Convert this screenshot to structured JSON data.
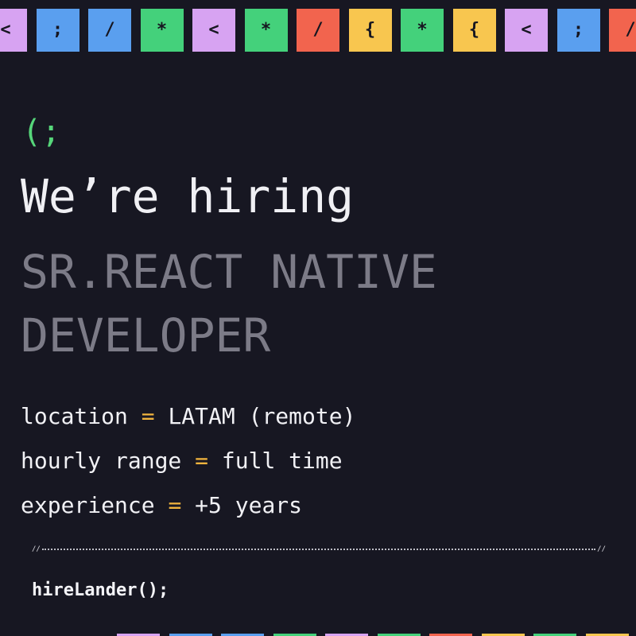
{
  "colors": {
    "background": "#171722",
    "purple": "#d7a3f2",
    "blue": "#5a9fef",
    "green": "#44d17b",
    "red": "#f2644e",
    "yellow": "#f8c64f",
    "equals_accent": "#f1b43e",
    "role_text": "#7c7b87"
  },
  "top_tiles": [
    {
      "glyph": "<",
      "color": "#d7a3f2"
    },
    {
      "glyph": ";",
      "color": "#5a9fef"
    },
    {
      "glyph": "/",
      "color": "#5a9fef"
    },
    {
      "glyph": "*",
      "color": "#44d17b"
    },
    {
      "glyph": "<",
      "color": "#d7a3f2"
    },
    {
      "glyph": "*",
      "color": "#44d17b"
    },
    {
      "glyph": "/",
      "color": "#f2644e"
    },
    {
      "glyph": "{",
      "color": "#f8c64f"
    },
    {
      "glyph": "*",
      "color": "#44d17b"
    },
    {
      "glyph": "{",
      "color": "#f8c64f"
    },
    {
      "glyph": "<",
      "color": "#d7a3f2"
    },
    {
      "glyph": ";",
      "color": "#5a9fef"
    },
    {
      "glyph": "/",
      "color": "#f2644e"
    }
  ],
  "bottom_strips": [
    "#d7a3f2",
    "#5a9fef",
    "#5a9fef",
    "#44d17b",
    "#d7a3f2",
    "#44d17b",
    "#f2644e",
    "#f8c64f",
    "#44d17b",
    "#f8c64f"
  ],
  "glyph": "(;",
  "headline": "We’re hiring",
  "role_lines": [
    "SR.REACT NATIVE",
    "DEVELOPER"
  ],
  "details": [
    {
      "key": "location",
      "op": "=",
      "value": "LATAM (remote)"
    },
    {
      "key": "hourly range",
      "op": "=",
      "value": "full time"
    },
    {
      "key": "experience",
      "op": "=",
      "value": "+5 years"
    }
  ],
  "divider": {
    "left": "//",
    "right": "//"
  },
  "call": "hireLander();"
}
